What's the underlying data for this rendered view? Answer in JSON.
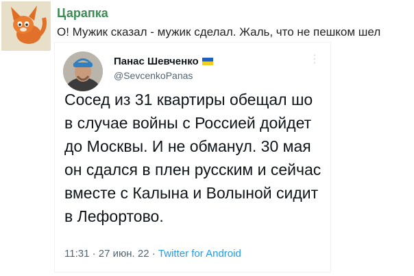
{
  "comment": {
    "author": "Царапка",
    "text": "О! Мужик сказал - мужик сделал. Жаль, что не пешком шел",
    "avatar_icon": "orange-cartoon-cat-avatar"
  },
  "tweet": {
    "display_name": "Панас Шевченко",
    "flag_icon": "ukraine-flag-icon",
    "handle": "@SevcenkoPanas",
    "body": "Сосед из 31 квартиры обещал шо в случае войны с Россией дойдет до Москвы. И не обманул. 30 мая он сдался в плен русским и сейчас вместе с Калына и Волыной сидит в Лефортово.",
    "time": "11:31",
    "date": "27 июн. 22",
    "separator": "·",
    "source": "Twitter for Android"
  },
  "colors": {
    "author": "#3d8a54",
    "tweet_text": "#0f1419",
    "tweet_meta": "#536471",
    "link": "#1d9bf0",
    "flag_blue": "#1f5fbf",
    "flag_yellow": "#f3cf1d"
  }
}
